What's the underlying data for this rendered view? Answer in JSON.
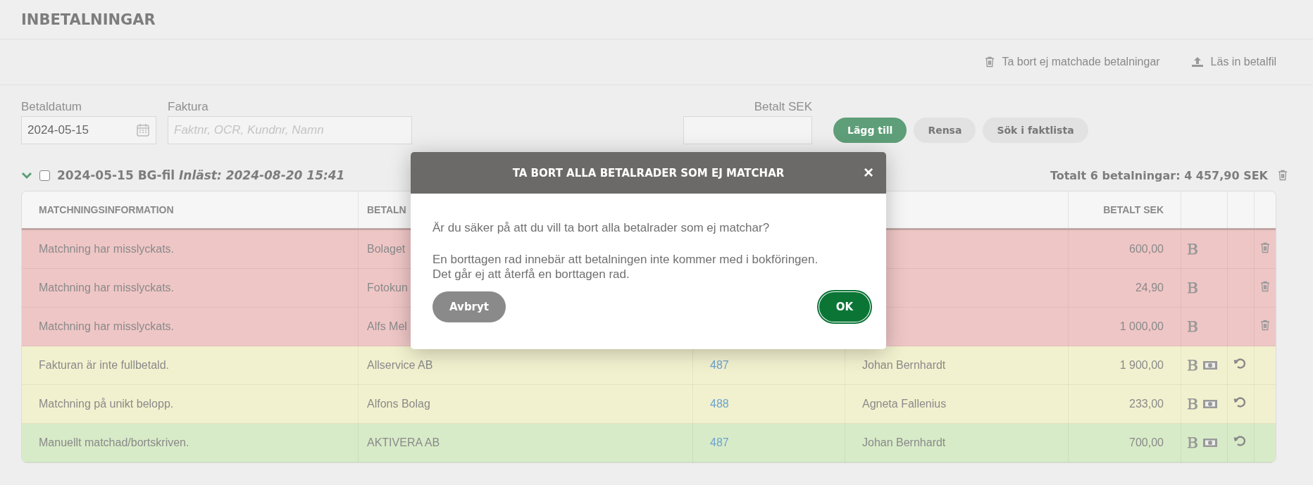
{
  "page_title": "INBETALNINGAR",
  "toolbar": [
    {
      "kind": "trash",
      "label": "Ta bort ej matchade betalningar"
    },
    {
      "kind": "upload",
      "label": "Läs in betalfil"
    }
  ],
  "form": {
    "date": {
      "label": "Betaldatum",
      "value": "2024-05-15"
    },
    "invoice": {
      "label": "Faktura",
      "placeholder": "Faktnr, OCR, Kundnr, Namn"
    },
    "amount": {
      "label": "Betalt SEK"
    },
    "buttons": [
      {
        "label": "Lägg till",
        "kind": "primary"
      },
      {
        "label": "Rensa",
        "kind": "secondary"
      },
      {
        "label": "Sök i faktlista",
        "kind": "secondary"
      }
    ]
  },
  "group": {
    "expanded": true,
    "checked": false,
    "title": "2024-05-15 BG-fil",
    "imported": "Inläst: 2024-08-20 15:41",
    "total": "Totalt 6 betalningar: 4 457,90 SEK"
  },
  "table": {
    "columns": [
      "MATCHNINGSINFORMATION",
      "BETALN",
      "",
      "",
      "BETALT SEK",
      "",
      "",
      ""
    ],
    "rows": [
      {
        "color": "#efc6c6",
        "info": "Matchning har misslyckats.",
        "payer": "Bolaget",
        "invoice": "",
        "customer": "",
        "amount": "600,00",
        "money": false,
        "undo": false,
        "trash": true
      },
      {
        "color": "#efc6c6",
        "info": "Matchning har misslyckats.",
        "payer": "Fotokun",
        "invoice": "",
        "customer": "",
        "amount": "24,90",
        "money": false,
        "undo": false,
        "trash": true
      },
      {
        "color": "#efc6c6",
        "info": "Matchning har misslyckats.",
        "payer": "Alfs Mel",
        "invoice": "",
        "customer": "",
        "amount": "1 000,00",
        "money": false,
        "undo": false,
        "trash": true
      },
      {
        "color": "#f2f1cf",
        "info": "Fakturan är inte fullbetald.",
        "payer": "Allservice AB",
        "invoice": "487",
        "customer": "Johan Bernhardt",
        "amount": "1 900,00",
        "money": true,
        "undo": true,
        "trash": false
      },
      {
        "color": "#f2f1cf",
        "info": "Matchning på unikt belopp.",
        "payer": "Alfons Bolag",
        "invoice": "488",
        "customer": "Agneta Fallenius",
        "amount": "233,00",
        "money": true,
        "undo": true,
        "trash": false
      },
      {
        "color": "#d8ebc8",
        "info": "Manuellt matchad/bortskriven.",
        "payer": "AKTIVERA AB",
        "invoice": "487",
        "customer": "Johan Bernhardt",
        "amount": "700,00",
        "money": true,
        "undo": true,
        "trash": false
      }
    ]
  },
  "dialog": {
    "title": "TA BORT ALLA BETALRADER SOM EJ MATCHAR",
    "close": "×",
    "question": "Är du säker på att du vill ta bort alla betalrader som ej matchar?",
    "note_1": "En borttagen rad innebär att betalningen inte kommer med i bokföringen.",
    "note_2": "Det går ej att återfå en borttagen rad.",
    "cancel": "Avbryt",
    "ok": "OK"
  }
}
